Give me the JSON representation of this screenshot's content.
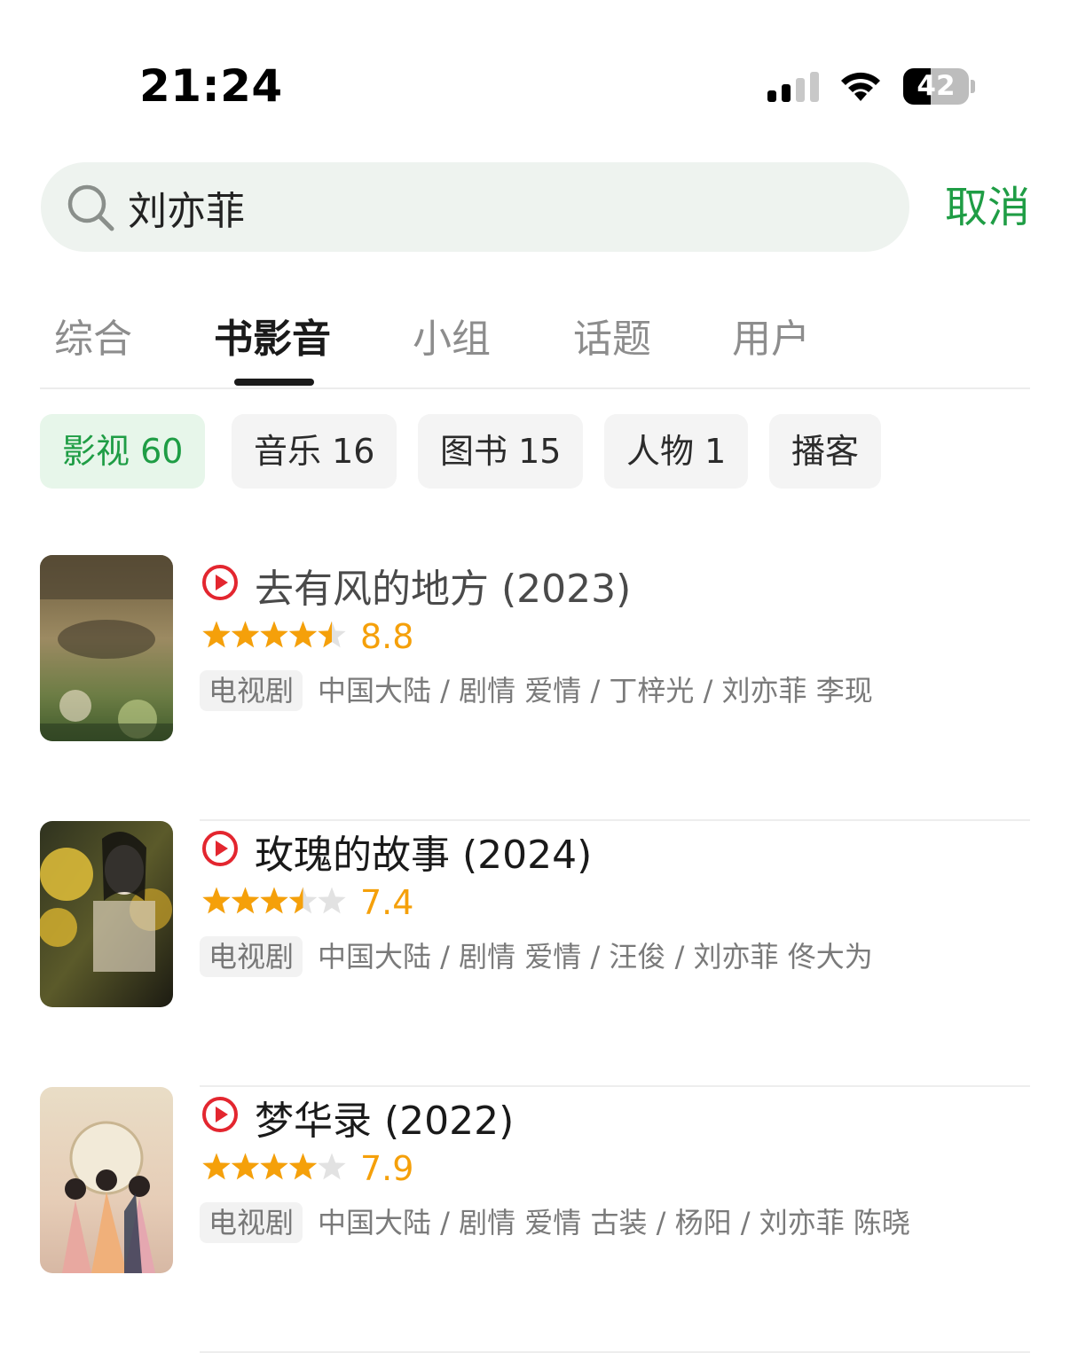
{
  "status_bar": {
    "time": "21:24",
    "battery_level": "42",
    "battery_fraction": 0.42,
    "cell_signal_bars": 2,
    "wifi_icon": "wifi-icon"
  },
  "search": {
    "query": "刘亦菲",
    "icon": "search-icon",
    "cancel_label": "取消"
  },
  "tabs": [
    {
      "label": "综合",
      "active": false
    },
    {
      "label": "书影音",
      "active": true
    },
    {
      "label": "小组",
      "active": false
    },
    {
      "label": "话题",
      "active": false
    },
    {
      "label": "用户",
      "active": false
    }
  ],
  "chips": [
    {
      "label": "影视 60",
      "active": true
    },
    {
      "label": "音乐 16",
      "active": false
    },
    {
      "label": "图书 15",
      "active": false
    },
    {
      "label": "人物 1",
      "active": false
    },
    {
      "label": "播客",
      "active": false
    }
  ],
  "colors": {
    "accent_green": "#1f9d45",
    "rating_orange": "#f5a00a",
    "play_red": "#e3262f"
  },
  "results": [
    {
      "title": "去有风的地方",
      "year": "(2023)",
      "title_color": "#4a4a4a",
      "rating": "8.8",
      "stars": 4.5,
      "type": "电视剧",
      "meta": "中国大陆 / 剧情 爱情 / 丁梓光 / 刘亦菲 李现",
      "poster": "poster-tv-1"
    },
    {
      "title": "玫瑰的故事",
      "year": "(2024)",
      "title_color": "#1a1a1a",
      "rating": "7.4",
      "stars": 3.5,
      "type": "电视剧",
      "meta": "中国大陆 / 剧情 爱情 / 汪俊 / 刘亦菲 佟大为",
      "poster": "poster-tv-2"
    },
    {
      "title": "梦华录",
      "year": "(2022)",
      "title_color": "#1a1a1a",
      "rating": "7.9",
      "stars": 4,
      "type": "电视剧",
      "meta": "中国大陆 / 剧情 爱情 古装 / 杨阳 / 刘亦菲 陈晓",
      "poster": "poster-tv-3"
    }
  ]
}
